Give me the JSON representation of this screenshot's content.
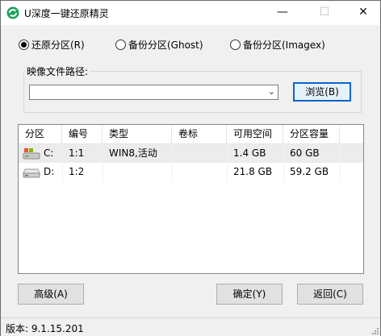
{
  "window": {
    "title": "U深度一键还原精灵",
    "controls": {
      "minimize": "—",
      "maximize": "☐",
      "close": "✕"
    }
  },
  "modes": [
    {
      "label": "还原分区(R)",
      "checked": true
    },
    {
      "label": "备份分区(Ghost)",
      "checked": false
    },
    {
      "label": "备份分区(Imagex)",
      "checked": false
    }
  ],
  "image_path": {
    "group_label": "映像文件路径:",
    "value": "",
    "browse_label": "浏览(B)"
  },
  "table": {
    "columns": [
      "分区",
      "编号",
      "类型",
      "卷标",
      "可用空间",
      "分区容量"
    ],
    "rows": [
      {
        "drive": "C:",
        "number": "1:1",
        "type": "WIN8,活动",
        "label": "",
        "free": "1.4 GB",
        "capacity": "60 GB",
        "icon": "system-drive-icon",
        "selected": true
      },
      {
        "drive": "D:",
        "number": "1:2",
        "type": "",
        "label": "",
        "free": "21.8 GB",
        "capacity": "59.2 GB",
        "icon": "hard-drive-icon",
        "selected": false
      }
    ]
  },
  "buttons": {
    "advanced": "高级(A)",
    "ok": "确定(Y)",
    "back": "返回(C)"
  },
  "status": {
    "version": "版本: 9.1.15.201"
  }
}
